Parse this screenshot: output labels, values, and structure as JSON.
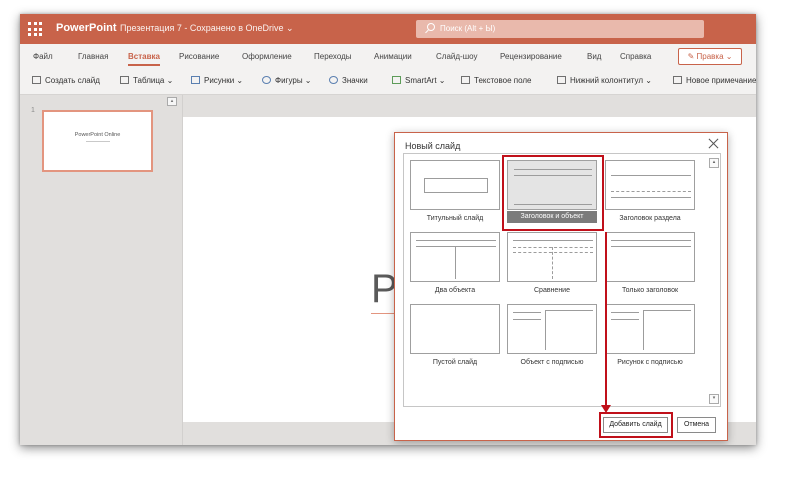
{
  "titlebar": {
    "app_name": "PowerPoint",
    "doc_title": "Презентация 7  -  Сохранено в OneDrive ⌄",
    "search_placeholder": "Поиск (Alt + Ы)"
  },
  "tabs": [
    {
      "label": "Файл",
      "active": false
    },
    {
      "label": "Главная",
      "active": false
    },
    {
      "label": "Вставка",
      "active": true
    },
    {
      "label": "Рисование",
      "active": false
    },
    {
      "label": "Оформление",
      "active": false
    },
    {
      "label": "Переходы",
      "active": false
    },
    {
      "label": "Анимации",
      "active": false
    },
    {
      "label": "Слайд-шоу",
      "active": false
    },
    {
      "label": "Рецензирование",
      "active": false
    },
    {
      "label": "Вид",
      "active": false
    },
    {
      "label": "Справка",
      "active": false
    }
  ],
  "edit_mode_label": "✎ Правка ⌄",
  "ribbon": {
    "new_slide": "Создать слайд",
    "table": "Таблица ⌄",
    "pictures": "Рисунки ⌄",
    "shapes": "Фигуры ⌄",
    "icons": "Значки",
    "smartart": "SmartArt ⌄",
    "textbox": "Текстовое поле",
    "footer": "Нижний колонтитул ⌄",
    "new_comment": "Новое примечание"
  },
  "thumbnails": {
    "number": "1",
    "title": "PowerPoint Online"
  },
  "slide_canvas": {
    "visible_text": "P"
  },
  "dialog": {
    "title": "Новый слайд",
    "layouts": [
      {
        "label": "Титульный слайд",
        "selected": false
      },
      {
        "label": "Заголовок и объект",
        "selected": true
      },
      {
        "label": "Заголовок раздела",
        "selected": false
      },
      {
        "label": "Два объекта",
        "selected": false
      },
      {
        "label": "Сравнение",
        "selected": false
      },
      {
        "label": "Только заголовок",
        "selected": false
      },
      {
        "label": "Пустой слайд",
        "selected": false
      },
      {
        "label": "Объект с подписью",
        "selected": false
      },
      {
        "label": "Рисунок с подписью",
        "selected": false
      }
    ],
    "add_button": "Добавить слайд",
    "cancel_button": "Отмена"
  },
  "colors": {
    "accent": "#c8634a",
    "highlight": "#c0101a"
  }
}
